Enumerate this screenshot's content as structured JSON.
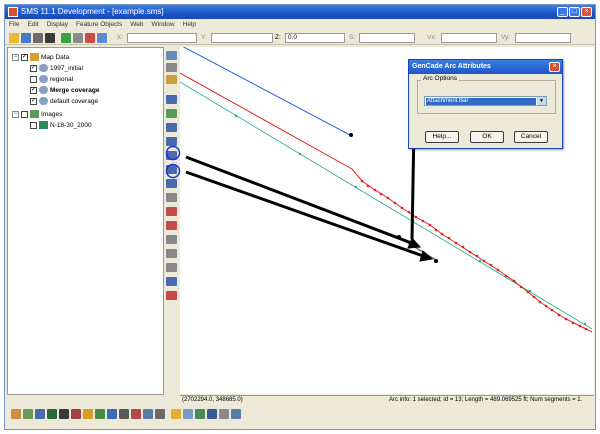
{
  "window": {
    "title": "SMS 11.1 Development - [example.sms]",
    "min": "_",
    "max": "□",
    "close": "×"
  },
  "menu": [
    "File",
    "Edit",
    "Display",
    "Feature Objects",
    "Web",
    "Window",
    "Help"
  ],
  "toolbar": {
    "x_label": "X:",
    "y_label": "Y:",
    "z_label": "Z:",
    "z_value": "0.0",
    "s_label": "S:",
    "vx_label": "Vx:",
    "vy_label": "Vy:"
  },
  "tree": {
    "expand": "−",
    "check": "✓",
    "map_data": "Map Data",
    "items": [
      "1997_initial",
      "regional",
      "Merge coverage",
      "default coverage"
    ],
    "images": "Images",
    "image_item": "N-18-30_2000"
  },
  "status": {
    "coords": "(2702294.0, 348685.0)",
    "arc_info": "Arc info: 1 selected; id = 13; Length = 489.069525 ft; Num segments = 1."
  },
  "dialog": {
    "title": "GenCade Arc Attributes",
    "close": "×",
    "group_label": "Arc Options",
    "selected": "Attachment Bar",
    "dropdown_arrow": "▼",
    "help": "Help...",
    "ok": "OK",
    "cancel": "Cancel"
  },
  "colors": {
    "accent": "#1f55c8",
    "red_arc": "#e02020",
    "blue_arc": "#2060e0",
    "teal_arc": "#2aa88a",
    "annotation": "#000000"
  }
}
